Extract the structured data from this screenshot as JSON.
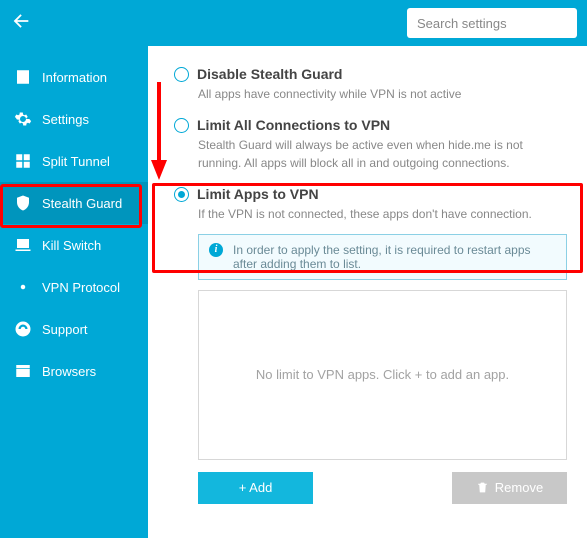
{
  "header": {
    "search_placeholder": "Search settings"
  },
  "sidebar": {
    "items": [
      {
        "label": "Information",
        "icon": "info-doc-icon",
        "active": false
      },
      {
        "label": "Settings",
        "icon": "gear-icon",
        "active": false
      },
      {
        "label": "Split Tunnel",
        "icon": "split-icon",
        "active": false
      },
      {
        "label": "Stealth Guard",
        "icon": "shield-icon",
        "active": true
      },
      {
        "label": "Kill Switch",
        "icon": "killswitch-icon",
        "active": false
      },
      {
        "label": "VPN Protocol",
        "icon": "protocol-icon",
        "active": false
      },
      {
        "label": "Support",
        "icon": "support-icon",
        "active": false
      },
      {
        "label": "Browsers",
        "icon": "browser-icon",
        "active": false
      }
    ]
  },
  "options": [
    {
      "title": "Disable Stealth Guard",
      "desc": "All apps have connectivity while VPN is not active",
      "selected": false
    },
    {
      "title": "Limit All Connections to VPN",
      "desc": "Stealth Guard will always be active even when hide.me is not running. All apps will block all in and outgoing connections.",
      "selected": false
    },
    {
      "title": "Limit Apps to VPN",
      "desc": "If the VPN is not connected, these apps don't have connection.",
      "selected": true
    }
  ],
  "info_notice": "In order to apply the setting, it is required to restart apps after adding them to list.",
  "apps_empty": "No limit to VPN apps. Click + to add an app.",
  "buttons": {
    "add": "+ Add",
    "remove": "Remove"
  },
  "colors": {
    "accent": "#00a8d6",
    "highlight": "#ff0000"
  }
}
